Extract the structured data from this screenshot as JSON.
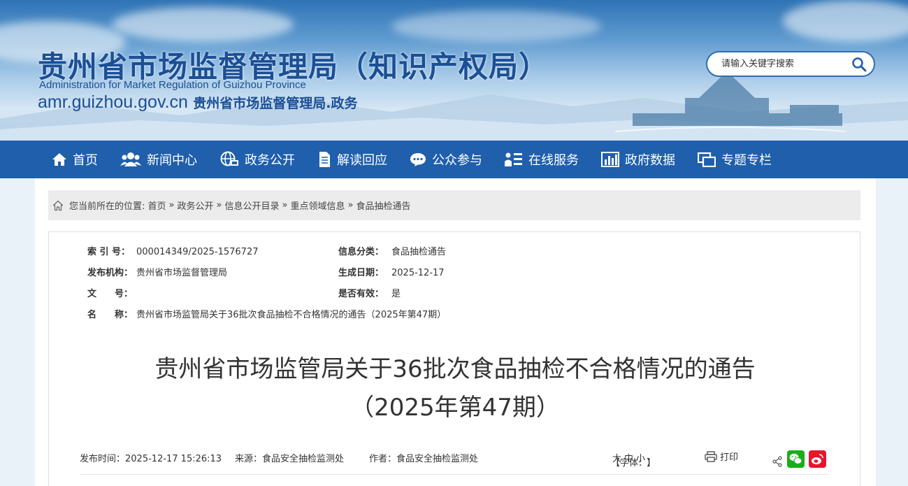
{
  "header": {
    "title": "贵州省市场监督管理局（知识产权局）",
    "title_en": "Administration for Market Regulation of Guizhou Province",
    "domain": "amr.guizhou.gov.cn",
    "domain_suffix": "贵州省市场监督管理局.政务",
    "search_placeholder": "请输入关键字搜索"
  },
  "nav": {
    "items": [
      {
        "label": "首页",
        "icon": "home-icon"
      },
      {
        "label": "新闻中心",
        "icon": "users-icon"
      },
      {
        "label": "政务公开",
        "icon": "globe-icon"
      },
      {
        "label": "解读回应",
        "icon": "document-icon"
      },
      {
        "label": "公众参与",
        "icon": "chat-icon"
      },
      {
        "label": "在线服务",
        "icon": "person-list-icon"
      },
      {
        "label": "政府数据",
        "icon": "bar-chart-icon"
      },
      {
        "label": "专题专栏",
        "icon": "windows-icon"
      }
    ]
  },
  "breadcrumb": {
    "prefix": "您当前所在的位置:",
    "items": [
      "首页",
      "政务公开",
      "信息公开目录",
      "重点领域信息",
      "食品抽检通告"
    ],
    "separator": "»"
  },
  "meta": {
    "index_no_label": "索 引 号：",
    "index_no": "000014349/2025-1576727",
    "category_label": "信息分类：",
    "category": "食品抽检通告",
    "publisher_label": "发布机构：",
    "publisher": "贵州省市场监督管理局",
    "date_label": "生成日期：",
    "date": "2025-12-17",
    "doc_no_label": "文　　号：",
    "doc_no": "",
    "valid_label": "是否有效：",
    "valid": "是",
    "name_label": "名　　称：",
    "name": "贵州省市场监管局关于36批次食品抽检不合格情况的通告（2025年第47期）"
  },
  "article": {
    "title_line1": "贵州省市场监管局关于36批次食品抽检不合格情况的通告",
    "title_line2": "（2025年第47期）",
    "publish_time": "发布时间：2025-12-17 15:26:13",
    "source": "来源：食品安全抽检监测处",
    "author": "作者：食品安全抽检监测处",
    "font_label_open": "【字体：",
    "font_large": "大",
    "font_medium": "中",
    "font_small": "小",
    "font_label_close": "】",
    "print_label": "打印"
  },
  "colors": {
    "nav_bg": "#1f5fac",
    "title_blue": "#1b4f96",
    "wechat_green": "#1aad19",
    "weibo_red": "#e6162d"
  }
}
